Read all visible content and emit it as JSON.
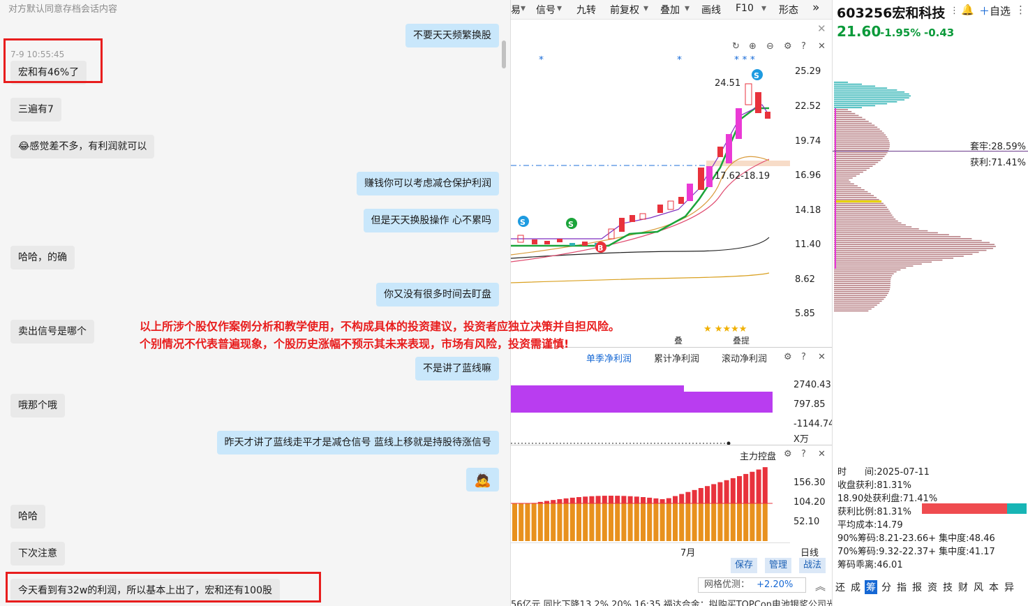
{
  "chat": {
    "header": "对方默认同意存档会话内容",
    "timestamp": "7-9 10:55:45",
    "messages": [
      {
        "side": "right",
        "text": "不要天天频繁换股"
      },
      {
        "side": "left",
        "text": "宏和有46%了"
      },
      {
        "side": "left",
        "text": "三遍有7"
      },
      {
        "side": "left",
        "text": "😂感觉差不多，有利润就可以"
      },
      {
        "side": "right",
        "text": "赚钱你可以考虑减仓保护利润"
      },
      {
        "side": "right",
        "text": "但是天天换股操作 心不累吗"
      },
      {
        "side": "left",
        "text": "哈哈，的确"
      },
      {
        "side": "right",
        "text": "你又没有很多时间去盯盘"
      },
      {
        "side": "left",
        "text": "卖出信号是哪个"
      },
      {
        "side": "right",
        "text": "不是讲了蓝线嘛"
      },
      {
        "side": "left",
        "text": "哦那个哦"
      },
      {
        "side": "right",
        "text": "昨天才讲了蓝线走平才是减仓信号 蓝线上移就是持股待涨信号"
      },
      {
        "side": "right",
        "text": "🙇"
      },
      {
        "side": "left",
        "text": "哈哈"
      },
      {
        "side": "left",
        "text": "下次注意"
      },
      {
        "side": "left",
        "text": "今天看到有32w的利润，所以基本上出了，宏和还有100股"
      }
    ],
    "disclaimer_line1": "以上所涉个股仅作案例分析和教学使用，不构成具体的投资建议，投资者应独立决策并自担风险。",
    "disclaimer_line2": "个别情况不代表普遍现象，个股历史涨幅不预示其未来表现，市场有风险，投资需谨慎!"
  },
  "toolbar": {
    "items": [
      "易",
      "信号",
      "九转",
      "前复权",
      "叠加",
      "画线",
      "F10",
      "形态"
    ]
  },
  "kline": {
    "price_ticks": [
      "25.29",
      "22.52",
      "19.74",
      "16.96",
      "14.18",
      "11.40",
      "8.62",
      "5.85"
    ],
    "high_label": "24.51",
    "range_label": "17.62-18.19",
    "bottom_tags": [
      "叠",
      "叠提"
    ],
    "signal_letters": [
      "S",
      "S",
      "S",
      "B"
    ]
  },
  "profit_panel": {
    "tabs": [
      "单季净利润",
      "累计净利润",
      "滚动净利润"
    ],
    "ticks": [
      "2740.43",
      "797.85",
      "-1144.74"
    ],
    "unit": "X万"
  },
  "main_control": {
    "title": "主力控盘",
    "ticks": [
      "156.30",
      "104.20",
      "52.10"
    ],
    "month_label": "7月",
    "period": "日线"
  },
  "chart_buttons": [
    "保存",
    "管理",
    "战法"
  ],
  "grid_optimize": {
    "label": "网格优测：",
    "value": "+2.20%"
  },
  "ticker_text": "56亿元 同比下降13.2% 20%      16:35 福达合金：拟购买TOPCon电池银浆公司光达电子不低于51%的股权",
  "stock": {
    "code": "603256",
    "name": "宏和科技",
    "price": "21.60",
    "change_pct": "-1.95%",
    "change": "-0.43",
    "add_watch": "自选"
  },
  "chips": {
    "trapped": "套牢:28.59%",
    "profit": "获利:71.41%",
    "stats": [
      "时　　间:2025-07-11",
      "收盘获利:81.31%",
      "18.90处获利盘:71.41%",
      "获利比例:81.31%",
      "平均成本:14.79",
      "90%筹码:8.21-23.66+ 集中度:48.46",
      "70%筹码:9.32-22.37+ 集中度:41.17",
      "筹码乖离:46.01"
    ],
    "profit_ratio": 0.8131
  },
  "bottom_tabs": [
    "还",
    "成",
    "筹",
    "分",
    "指",
    "报",
    "资",
    "技",
    "财",
    "风",
    "本",
    "异"
  ],
  "colors": {
    "up": "#e8323c",
    "down": "#0b9a3a",
    "accent": "#1668d4",
    "chip_profit": "#b77f84",
    "chip_top": "#2fb3b5"
  }
}
